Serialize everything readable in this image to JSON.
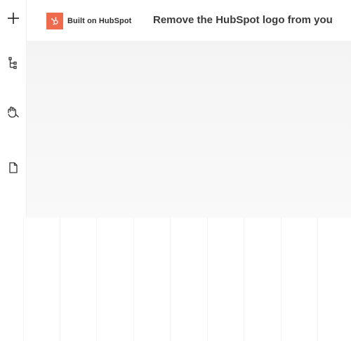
{
  "rail": {
    "add_icon": "plus-icon",
    "tree_icon": "tree-structure-icon",
    "hand_icon": "grab-hand-icon",
    "page_icon": "page-icon"
  },
  "banner": {
    "badge_label": "Built on HubSpot",
    "message": "Remove the HubSpot logo from you"
  },
  "colors": {
    "brand": "#ee6b4d",
    "text": "#3a3a3a"
  }
}
